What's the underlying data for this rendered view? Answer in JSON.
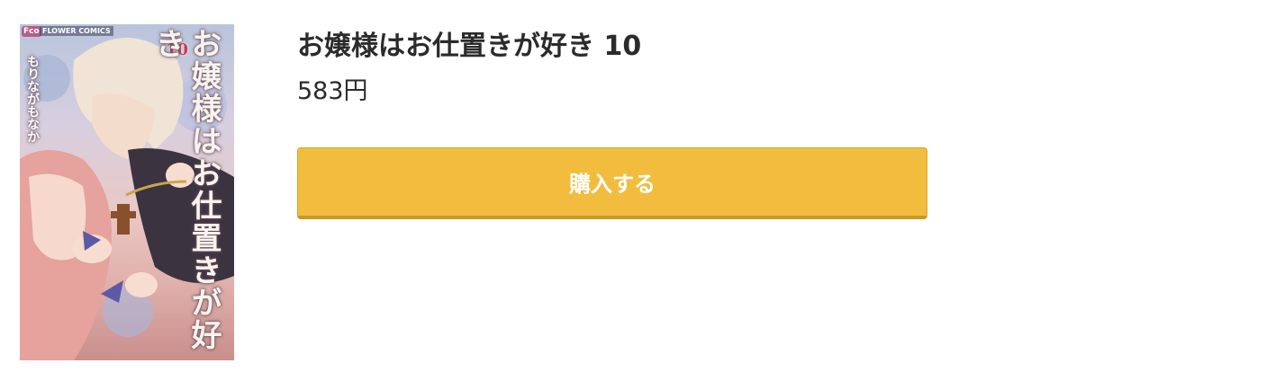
{
  "product": {
    "title": "お嬢様はお仕置きが好き 10",
    "price": "583円",
    "buy_label": "購入する"
  },
  "cover": {
    "title_text": "お嬢様はお仕置きが好き",
    "author_text": "もりながもなか",
    "volume_text": "10",
    "label_text": "FLOWER COMICS",
    "logo_text": "Fco"
  },
  "colors": {
    "button_bg": "#f2bd3e",
    "button_border": "#c9982a",
    "text": "#2b2b2b"
  }
}
